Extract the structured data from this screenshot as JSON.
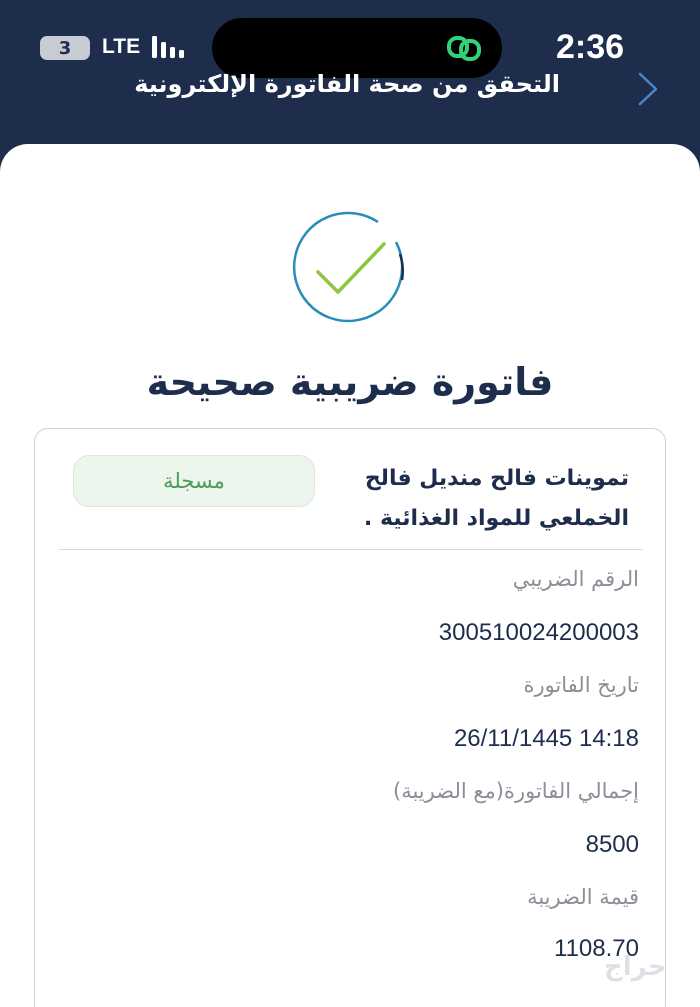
{
  "status_bar": {
    "signal_badge": "3",
    "network": "LTE",
    "time": "2:36"
  },
  "header": {
    "title": "التحقق من صحة الفاتورة الإلكترونية",
    "back_icon": "chevron-icon"
  },
  "result": {
    "icon": "check-circle-icon",
    "title": "فاتورة ضريبية صحيحة"
  },
  "invoice": {
    "vendor_name": "تموينات فالح منديل فالح الخملعي للمواد الغذائية .",
    "status": "مسجلة",
    "fields": [
      {
        "label": "الرقم الضريبي",
        "value": "300510024200003"
      },
      {
        "label": "تاريخ الفاتورة",
        "value": "26/11/1445 14:18"
      },
      {
        "label": "إجمالي الفاتورة(مع الضريبة)",
        "value": "8500"
      },
      {
        "label": "قيمة الضريبة",
        "value": "1108.70"
      }
    ]
  },
  "colors": {
    "header_bg": "#1e2d4c",
    "title_text": "#1e2d4c",
    "status_green": "#4c9b58",
    "status_bg": "#ecf6ec",
    "check_green": "#8cc63f",
    "ring_blue": "#2a8cb8"
  }
}
